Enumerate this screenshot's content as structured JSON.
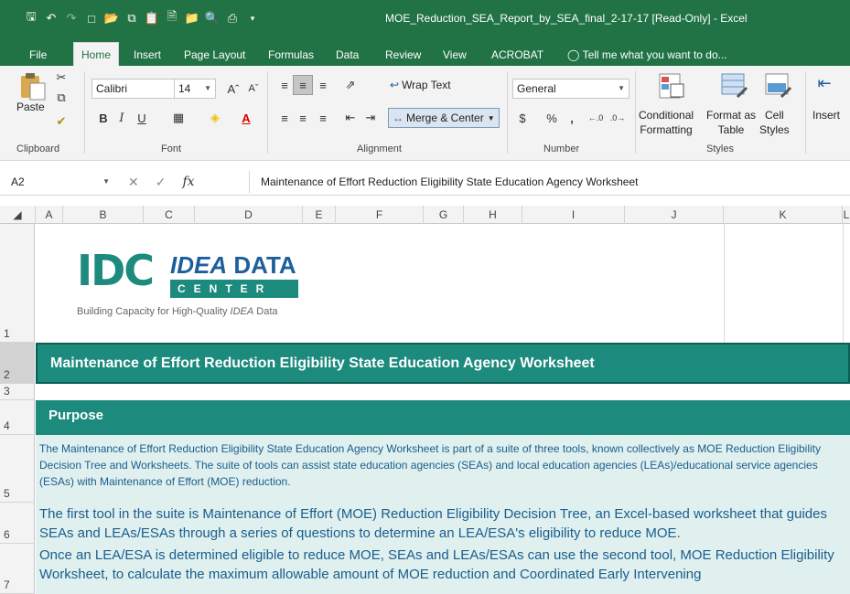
{
  "window": {
    "title": "MOE_Reduction_SEA_Report_by_SEA_final_2-17-17  [Read-Only] - Excel"
  },
  "tabs": [
    "File",
    "Home",
    "Insert",
    "Page Layout",
    "Formulas",
    "Data",
    "Review",
    "View",
    "ACROBAT"
  ],
  "active_tab": "Home",
  "tell_me": "Tell me what you want to do...",
  "ribbon": {
    "clipboard": {
      "label": "Clipboard",
      "paste": "Paste"
    },
    "font": {
      "label": "Font",
      "name": "Calibri",
      "size": "14",
      "bold": "B",
      "italic": "I",
      "underline": "U"
    },
    "alignment": {
      "label": "Alignment",
      "wrap_text": "Wrap Text",
      "merge_center": "Merge & Center"
    },
    "number": {
      "label": "Number",
      "format": "General",
      "currency": "$",
      "percent": "%",
      "comma": ","
    },
    "styles": {
      "label": "Styles",
      "conditional_1": "Conditional",
      "conditional_2": "Formatting",
      "format_as_1": "Format as",
      "format_as_2": "Table",
      "cell_1": "Cell",
      "cell_2": "Styles"
    },
    "cells": {
      "insert": "Insert"
    }
  },
  "formula_bar": {
    "name_box": "A2",
    "fx": "fx",
    "content": "Maintenance of Effort Reduction Eligibility State Education Agency Worksheet"
  },
  "columns": [
    "A",
    "B",
    "C",
    "D",
    "E",
    "F",
    "G",
    "H",
    "I",
    "J",
    "K",
    "L"
  ],
  "rows": [
    "1",
    "2",
    "3",
    "4",
    "5",
    "6",
    "7"
  ],
  "logo": {
    "mark": "IDC",
    "idea": "IDEA",
    "data": "DATA",
    "center": "CENTER",
    "tagline_a": "Building Capacity for High-Quality ",
    "tagline_idea": "IDEA",
    "tagline_b": " Data"
  },
  "sheet": {
    "title": "Maintenance of Effort Reduction Eligibility State Education Agency Worksheet",
    "purpose_heading": "Purpose",
    "para1": "The Maintenance of Effort Reduction Eligibility State Education Agency Worksheet is part of a suite of three tools, known collectively as MOE Reduction Eligibility Decision Tree and Worksheets. The suite of tools can assist state education agencies (SEAs) and local education agencies (LEAs)/educational service agencies (ESAs) with Maintenance of Effort (MOE) reduction.",
    "para2": "The first tool in the suite is Maintenance of Effort (MOE) Reduction Eligibility Decision Tree, an Excel-based worksheet that guides SEAs and LEAs/ESAs through a series of questions to determine an LEA/ESA's eligibility to reduce MOE.",
    "para3": "Once an LEA/ESA is determined eligible to reduce MOE, SEAs and LEAs/ESAs can use the second tool, MOE Reduction Eligibility Worksheet, to calculate the maximum allowable amount of MOE reduction and Coordinated Early Intervening"
  },
  "colors": {
    "excel_green": "#217346",
    "banner_teal": "#1c8a7c",
    "body_fill": "#dff0ee",
    "body_text": "#1a5d8f"
  }
}
